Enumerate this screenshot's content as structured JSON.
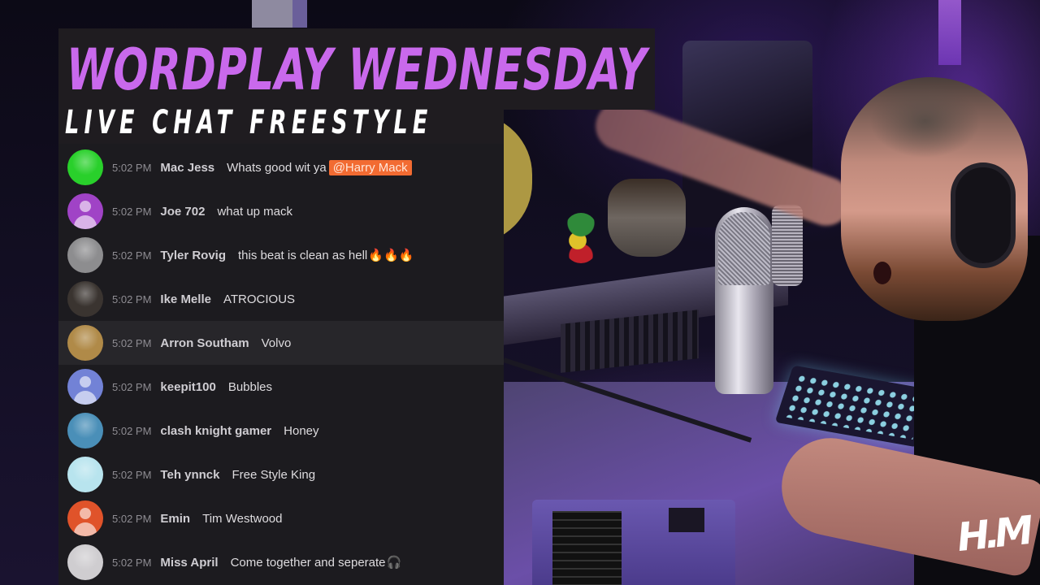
{
  "banner": {
    "title": "WORDPLAY WEDNESDAY",
    "subtitle": "LIVE CHAT FREESTYLE",
    "title_color": "#c969ec"
  },
  "chat": {
    "mention_color": "#f26b32",
    "messages": [
      {
        "time": "5:02 PM",
        "author": "Mac Jess",
        "text": "Whats good wit ya",
        "mention": "@Harry Mack",
        "emoji": "",
        "avatar": "photo-cartoon-face",
        "avatar_color": "#29d02b",
        "highlighted": false
      },
      {
        "time": "5:02 PM",
        "author": "Joe 702",
        "text": "what up mack",
        "mention": "",
        "emoji": "",
        "avatar": "default-person",
        "avatar_color": "#a043c6",
        "highlighted": false
      },
      {
        "time": "5:02 PM",
        "author": "Tyler Rovig",
        "text": "this beat is clean as hell",
        "mention": "",
        "emoji": "🔥🔥🔥",
        "avatar": "photo-bw",
        "avatar_color": "#8d8d8f",
        "highlighted": false
      },
      {
        "time": "5:02 PM",
        "author": "Ike Melle",
        "text": "ATROCIOUS",
        "mention": "",
        "emoji": "",
        "avatar": "photo-portrait",
        "avatar_color": "#3a3430",
        "highlighted": false
      },
      {
        "time": "5:02 PM",
        "author": "Arron Southam",
        "text": "Volvo",
        "mention": "",
        "emoji": "",
        "avatar": "photo-field",
        "avatar_color": "#b08a48",
        "highlighted": true
      },
      {
        "time": "5:02 PM",
        "author": "keepit100",
        "text": "Bubbles",
        "mention": "",
        "emoji": "",
        "avatar": "default-person",
        "avatar_color": "#7282d6",
        "highlighted": false
      },
      {
        "time": "5:02 PM",
        "author": "clash knight gamer",
        "text": "Honey",
        "mention": "",
        "emoji": "",
        "avatar": "photo-game-character",
        "avatar_color": "#4a8fb8",
        "highlighted": false
      },
      {
        "time": "5:02 PM",
        "author": "Teh ynnck",
        "text": "Free Style King",
        "mention": "",
        "emoji": "",
        "avatar": "photo-beach",
        "avatar_color": "#b8e4ee",
        "highlighted": false
      },
      {
        "time": "5:02 PM",
        "author": "Emin",
        "text": "Tim Westwood",
        "mention": "",
        "emoji": "",
        "avatar": "default-person",
        "avatar_color": "#e0532a",
        "highlighted": false
      },
      {
        "time": "5:02 PM",
        "author": "Miss April",
        "text": "Come together and seperate",
        "mention": "",
        "emoji": "🎧",
        "avatar": "photo-bw-woman",
        "avatar_color": "#cfcdd0",
        "highlighted": false
      }
    ]
  },
  "watermark": {
    "logo_text": "H.M"
  }
}
